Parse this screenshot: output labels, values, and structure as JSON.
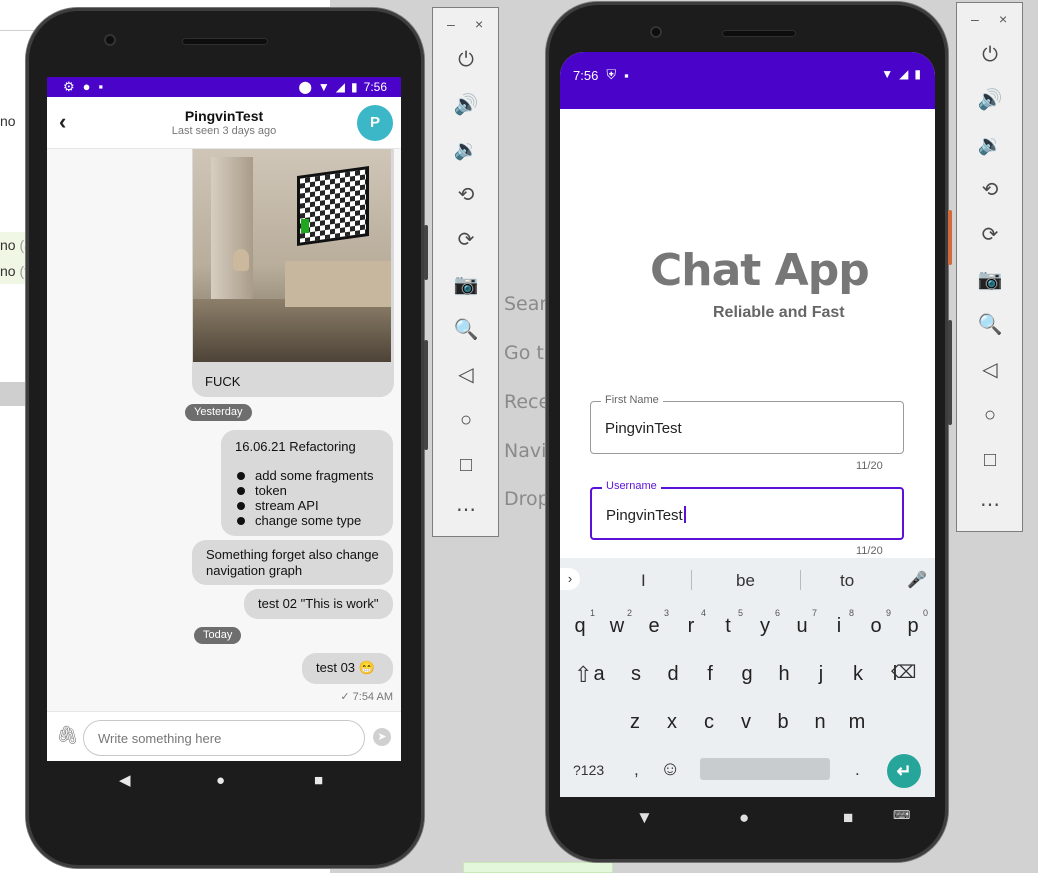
{
  "background": {
    "left_fragments": [
      "no",
      "no",
      "(a",
      "no",
      "(t"
    ],
    "menu_items": [
      "Searc",
      "Go to",
      "Rece",
      "Navi",
      "Drop"
    ]
  },
  "emulator_controls": {
    "minimize": "–",
    "close": "×",
    "buttons": [
      "power-icon",
      "volume-up-icon",
      "volume-down-icon",
      "rotate-left-icon",
      "rotate-right-icon",
      "camera-icon",
      "zoom-icon",
      "back-icon",
      "home-icon",
      "overview-icon",
      "more-icon"
    ]
  },
  "chat_phone": {
    "status_bar": {
      "time": "7:56"
    },
    "header": {
      "title": "PingvinTest",
      "subtitle": "Last seen 3 days ago",
      "avatar_letter": "P",
      "avatar_color": "#3cb7c7"
    },
    "messages": [
      {
        "type": "image",
        "caption": "FUCK"
      },
      {
        "type": "date",
        "label": "Yesterday"
      },
      {
        "type": "text",
        "title": "16.06.21 Refactoring",
        "items": [
          "add some fragments",
          "token",
          "stream API",
          "change some type"
        ]
      },
      {
        "type": "text",
        "text": "Something forget also change navigation graph"
      },
      {
        "type": "text",
        "text": "test 02 \"This is work\""
      },
      {
        "type": "date",
        "label": "Today"
      },
      {
        "type": "text",
        "text": "test 03 😁",
        "time": "7:54 AM",
        "check": "✓"
      }
    ],
    "input": {
      "placeholder": "Write something here"
    },
    "accent": "#4a04c9"
  },
  "login_phone": {
    "status_bar": {
      "time": "7:56"
    },
    "app_title": "Chat App",
    "tagline": "Reliable and Fast",
    "fields": [
      {
        "label": "First Name",
        "value": "PingvinTest",
        "counter": "11/20"
      },
      {
        "label": "Username",
        "value": "PingvinTest",
        "counter": "11/20"
      }
    ],
    "keyboard": {
      "suggestions": [
        "I",
        "be",
        "to"
      ],
      "row1": [
        "q",
        "w",
        "e",
        "r",
        "t",
        "y",
        "u",
        "i",
        "o",
        "p"
      ],
      "row1_hints": [
        "1",
        "2",
        "3",
        "4",
        "5",
        "6",
        "7",
        "8",
        "9",
        "0"
      ],
      "row2": [
        "a",
        "s",
        "d",
        "f",
        "g",
        "h",
        "j",
        "k",
        "l"
      ],
      "row3": [
        "z",
        "x",
        "c",
        "v",
        "b",
        "n",
        "m"
      ],
      "symbols_key": "?123",
      "comma": ",",
      "period": "."
    },
    "accent": "#5b12d8"
  }
}
